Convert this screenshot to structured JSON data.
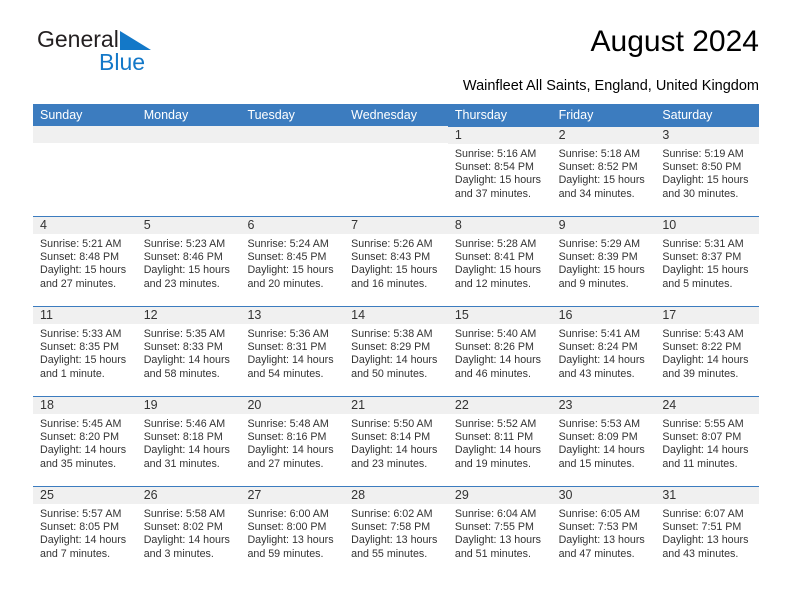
{
  "brand": {
    "name_part1": "General",
    "name_part2": "Blue",
    "triangle_color": "#1378c8"
  },
  "header": {
    "title": "August 2024",
    "subtitle": "Wainfleet All Saints, England, United Kingdom"
  },
  "theme": {
    "header_blue": "#3c7cbf",
    "daynum_band": "#f0f0f0",
    "text": "#333333"
  },
  "weekdays": [
    "Sunday",
    "Monday",
    "Tuesday",
    "Wednesday",
    "Thursday",
    "Friday",
    "Saturday"
  ],
  "weeks": [
    [
      {
        "day": "",
        "empty": true
      },
      {
        "day": "",
        "empty": true
      },
      {
        "day": "",
        "empty": true
      },
      {
        "day": "",
        "empty": true
      },
      {
        "day": "1",
        "sunrise": "Sunrise: 5:16 AM",
        "sunset": "Sunset: 8:54 PM",
        "daylight": "Daylight: 15 hours and 37 minutes."
      },
      {
        "day": "2",
        "sunrise": "Sunrise: 5:18 AM",
        "sunset": "Sunset: 8:52 PM",
        "daylight": "Daylight: 15 hours and 34 minutes."
      },
      {
        "day": "3",
        "sunrise": "Sunrise: 5:19 AM",
        "sunset": "Sunset: 8:50 PM",
        "daylight": "Daylight: 15 hours and 30 minutes."
      }
    ],
    [
      {
        "day": "4",
        "sunrise": "Sunrise: 5:21 AM",
        "sunset": "Sunset: 8:48 PM",
        "daylight": "Daylight: 15 hours and 27 minutes."
      },
      {
        "day": "5",
        "sunrise": "Sunrise: 5:23 AM",
        "sunset": "Sunset: 8:46 PM",
        "daylight": "Daylight: 15 hours and 23 minutes."
      },
      {
        "day": "6",
        "sunrise": "Sunrise: 5:24 AM",
        "sunset": "Sunset: 8:45 PM",
        "daylight": "Daylight: 15 hours and 20 minutes."
      },
      {
        "day": "7",
        "sunrise": "Sunrise: 5:26 AM",
        "sunset": "Sunset: 8:43 PM",
        "daylight": "Daylight: 15 hours and 16 minutes."
      },
      {
        "day": "8",
        "sunrise": "Sunrise: 5:28 AM",
        "sunset": "Sunset: 8:41 PM",
        "daylight": "Daylight: 15 hours and 12 minutes."
      },
      {
        "day": "9",
        "sunrise": "Sunrise: 5:29 AM",
        "sunset": "Sunset: 8:39 PM",
        "daylight": "Daylight: 15 hours and 9 minutes."
      },
      {
        "day": "10",
        "sunrise": "Sunrise: 5:31 AM",
        "sunset": "Sunset: 8:37 PM",
        "daylight": "Daylight: 15 hours and 5 minutes."
      }
    ],
    [
      {
        "day": "11",
        "sunrise": "Sunrise: 5:33 AM",
        "sunset": "Sunset: 8:35 PM",
        "daylight": "Daylight: 15 hours and 1 minute."
      },
      {
        "day": "12",
        "sunrise": "Sunrise: 5:35 AM",
        "sunset": "Sunset: 8:33 PM",
        "daylight": "Daylight: 14 hours and 58 minutes."
      },
      {
        "day": "13",
        "sunrise": "Sunrise: 5:36 AM",
        "sunset": "Sunset: 8:31 PM",
        "daylight": "Daylight: 14 hours and 54 minutes."
      },
      {
        "day": "14",
        "sunrise": "Sunrise: 5:38 AM",
        "sunset": "Sunset: 8:29 PM",
        "daylight": "Daylight: 14 hours and 50 minutes."
      },
      {
        "day": "15",
        "sunrise": "Sunrise: 5:40 AM",
        "sunset": "Sunset: 8:26 PM",
        "daylight": "Daylight: 14 hours and 46 minutes."
      },
      {
        "day": "16",
        "sunrise": "Sunrise: 5:41 AM",
        "sunset": "Sunset: 8:24 PM",
        "daylight": "Daylight: 14 hours and 43 minutes."
      },
      {
        "day": "17",
        "sunrise": "Sunrise: 5:43 AM",
        "sunset": "Sunset: 8:22 PM",
        "daylight": "Daylight: 14 hours and 39 minutes."
      }
    ],
    [
      {
        "day": "18",
        "sunrise": "Sunrise: 5:45 AM",
        "sunset": "Sunset: 8:20 PM",
        "daylight": "Daylight: 14 hours and 35 minutes."
      },
      {
        "day": "19",
        "sunrise": "Sunrise: 5:46 AM",
        "sunset": "Sunset: 8:18 PM",
        "daylight": "Daylight: 14 hours and 31 minutes."
      },
      {
        "day": "20",
        "sunrise": "Sunrise: 5:48 AM",
        "sunset": "Sunset: 8:16 PM",
        "daylight": "Daylight: 14 hours and 27 minutes."
      },
      {
        "day": "21",
        "sunrise": "Sunrise: 5:50 AM",
        "sunset": "Sunset: 8:14 PM",
        "daylight": "Daylight: 14 hours and 23 minutes."
      },
      {
        "day": "22",
        "sunrise": "Sunrise: 5:52 AM",
        "sunset": "Sunset: 8:11 PM",
        "daylight": "Daylight: 14 hours and 19 minutes."
      },
      {
        "day": "23",
        "sunrise": "Sunrise: 5:53 AM",
        "sunset": "Sunset: 8:09 PM",
        "daylight": "Daylight: 14 hours and 15 minutes."
      },
      {
        "day": "24",
        "sunrise": "Sunrise: 5:55 AM",
        "sunset": "Sunset: 8:07 PM",
        "daylight": "Daylight: 14 hours and 11 minutes."
      }
    ],
    [
      {
        "day": "25",
        "sunrise": "Sunrise: 5:57 AM",
        "sunset": "Sunset: 8:05 PM",
        "daylight": "Daylight: 14 hours and 7 minutes."
      },
      {
        "day": "26",
        "sunrise": "Sunrise: 5:58 AM",
        "sunset": "Sunset: 8:02 PM",
        "daylight": "Daylight: 14 hours and 3 minutes."
      },
      {
        "day": "27",
        "sunrise": "Sunrise: 6:00 AM",
        "sunset": "Sunset: 8:00 PM",
        "daylight": "Daylight: 13 hours and 59 minutes."
      },
      {
        "day": "28",
        "sunrise": "Sunrise: 6:02 AM",
        "sunset": "Sunset: 7:58 PM",
        "daylight": "Daylight: 13 hours and 55 minutes."
      },
      {
        "day": "29",
        "sunrise": "Sunrise: 6:04 AM",
        "sunset": "Sunset: 7:55 PM",
        "daylight": "Daylight: 13 hours and 51 minutes."
      },
      {
        "day": "30",
        "sunrise": "Sunrise: 6:05 AM",
        "sunset": "Sunset: 7:53 PM",
        "daylight": "Daylight: 13 hours and 47 minutes."
      },
      {
        "day": "31",
        "sunrise": "Sunrise: 6:07 AM",
        "sunset": "Sunset: 7:51 PM",
        "daylight": "Daylight: 13 hours and 43 minutes."
      }
    ]
  ]
}
